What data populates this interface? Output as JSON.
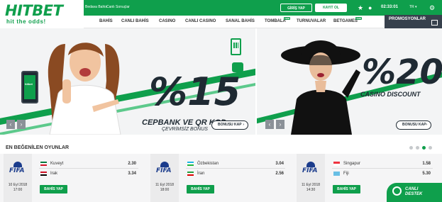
{
  "brand": {
    "logo": "HITBET",
    "tagline": "hit the odds!",
    "color_primary": "#0f9f4c",
    "color_dark": "#1f2a33"
  },
  "topbar": {
    "links": [
      "Bedava Bahis",
      "Canlı Sonuçlar"
    ],
    "login_label": "GİRİŞ YAP",
    "register_label": "KAYIT OL",
    "icons": [
      "star-icon",
      "user-icon",
      "settings-icon"
    ],
    "clock": "02:33:01",
    "language": "TR"
  },
  "nav": {
    "items": [
      {
        "label": "BAHİS",
        "badge": ""
      },
      {
        "label": "CANLI BAHİS",
        "badge": ""
      },
      {
        "label": "CASINO",
        "badge": ""
      },
      {
        "label": "CANLI CASINO",
        "badge": ""
      },
      {
        "label": "SANAL BAHİS",
        "badge": ""
      },
      {
        "label": "TOMBALA",
        "badge": "YENİ"
      },
      {
        "label": "TURNUVALAR",
        "badge": ""
      },
      {
        "label": "BETGAMES",
        "badge": "YENİ"
      }
    ],
    "promo_label": "PROMOSYONLAR"
  },
  "banners": {
    "left": {
      "percent": "%15",
      "line1": "CEPBANK VE QR KOD",
      "line2": "ÇEVRİMSİZ BONUS",
      "button": "BONUSU KAP",
      "phone_brand": "hitbet"
    },
    "right": {
      "percent": "%20",
      "line1": "CASINO DISCOUNT",
      "button": "BONUSU KAP"
    }
  },
  "games": {
    "title": "EN BEĞENİLEN OYUNLAR",
    "carousel_dots": 4,
    "active_dot": 2,
    "matches": [
      {
        "league": "FIFA",
        "date": "10 Eyl 2018",
        "time": "17:00",
        "home": "Kuveyt",
        "home_odd": "2.30",
        "away": "Irak",
        "away_odd": "3.34",
        "button": "BAHİS YAP"
      },
      {
        "league": "FIFA",
        "date": "11 Eyl 2018",
        "time": "18:00",
        "home": "Özbekistan",
        "home_odd": "3.04",
        "away": "İran",
        "away_odd": "2.56",
        "button": "BAHİS YAP"
      },
      {
        "league": "FIFA",
        "date": "11 Eyl 2018",
        "time": "14:30",
        "home": "Singapur",
        "home_odd": "1.58",
        "away": "Fiji",
        "away_odd": "5.30",
        "button": "BAHİS YAP"
      }
    ]
  },
  "live_support": {
    "line1": "CANLI",
    "line2": "DESTEK"
  }
}
